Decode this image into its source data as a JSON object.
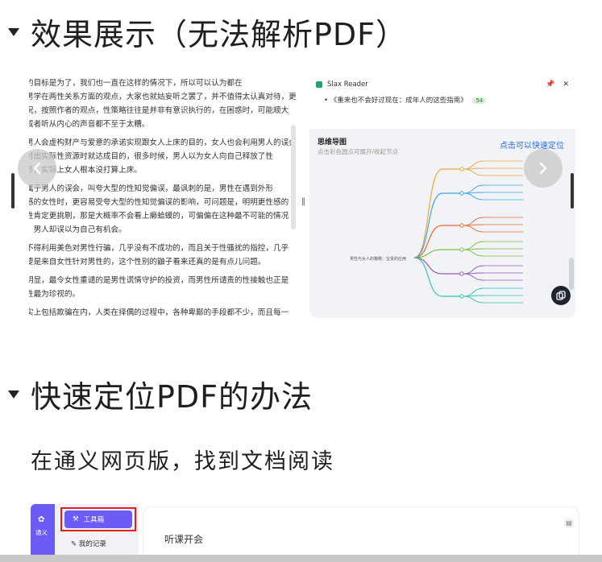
{
  "headings": {
    "demo": "效果展示（无法解析PDF）",
    "locate": "快速定位PDF的办法"
  },
  "subtitle": "在通义网页版，找到文档阅读",
  "doc_text": [
    "的目标是为了，我们也一直在这样的情况下，所以可以认为都在",
    "男学在两性关系方面的观点，大家也就姑妄听之罢了，并不值得太认真对待，更",
    "况，按照作者的观点，性策略往往是并非有意识执行的，在困惑时，可能顺大",
    "戒者听从内心的声音都不至于太糟。",
    "男人会虚构财产与爱意的承诺实现跟女人上床的目的，女人也会利用男人的误会",
    "付出实际性资源时就达成目的，很多时候，男人以为女人向自己释放了性",
    "号，实际上女人根本没打算上床。",
    "属于男人的误会，叫夸大型的性知觉偏误，最讽刺的是，男性在遇到外形",
    "感的女性时，更容易受夸大型的性知觉偏误的影响，可问题是，明明更性感的",
    "性肯定更挑剔，那是大概率不会看上癞蛤蟆的，可偏偏在这种最不可能的情况",
    "，男人却误以为自己有机会。",
    "不得利用美色对男性行骗，几乎没有不成功的，而且关于性骚扰的指控，几乎",
    "要是来自女性针对男性的，这个性别的鼬子看来还真的是有点儿问题。",
    "明显，最令女性重谴的是男性谎情守护的投资，而男性所谴责的性接触也正是",
    "性最为珍视的。",
    "实上包括欺骗在内，人类在择偶的过程中，各种卑鄙的手段都不少，而且每一"
  ],
  "reader": {
    "app_name": "Slax Reader",
    "link_text": "《重来也不会好过现在：成年人的这些指南》",
    "link_badge": "54",
    "mind_title": "思维导图",
    "mind_subtitle": "点击彩色圆点可展开/收起节点",
    "locate_link": "点击可以快速定位",
    "root_node": "男性与女人的策略：宝贵的应用",
    "node_colors": [
      "#e9a93a",
      "#3aa7e9",
      "#e96a3a",
      "#7bc043",
      "#9b59b6",
      "#2ec4b6"
    ]
  },
  "bottom": {
    "brand": "通义",
    "tool_button": "工具箱",
    "my_record": "我的记录",
    "main_title": "听课开会"
  }
}
